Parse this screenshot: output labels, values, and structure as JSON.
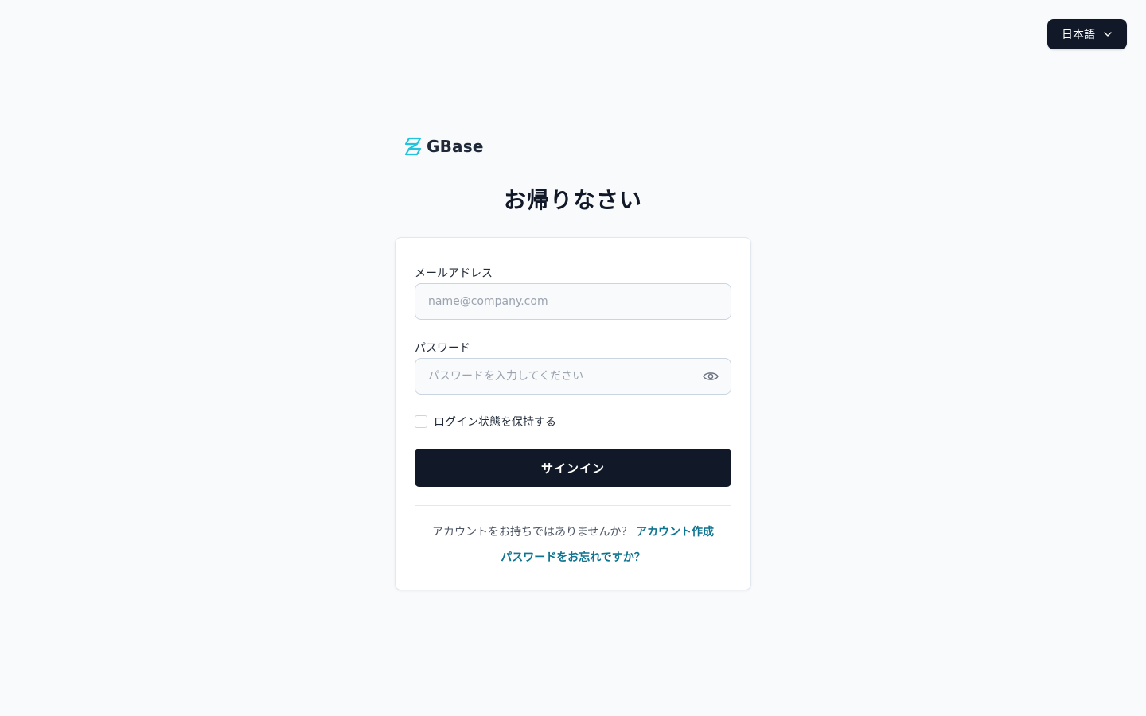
{
  "language": {
    "selected": "日本語"
  },
  "brand": {
    "name": "GBase",
    "accent": "#22c3dd"
  },
  "page": {
    "title": "お帰りなさい"
  },
  "form": {
    "email": {
      "label": "メールアドレス",
      "placeholder": "name@company.com",
      "value": ""
    },
    "password": {
      "label": "パスワード",
      "placeholder": "パスワードを入力してください",
      "value": ""
    },
    "remember": {
      "label": "ログイン状態を保持する",
      "checked": false
    },
    "submit_label": "サインイン"
  },
  "footer": {
    "no_account_text": "アカウントをお持ちではありませんか？",
    "create_account_link": "アカウント作成",
    "forgot_password_link": "パスワードをお忘れですか？"
  },
  "colors": {
    "background": "#f8fafc",
    "primary_button": "#111827",
    "link": "#0e7490"
  }
}
